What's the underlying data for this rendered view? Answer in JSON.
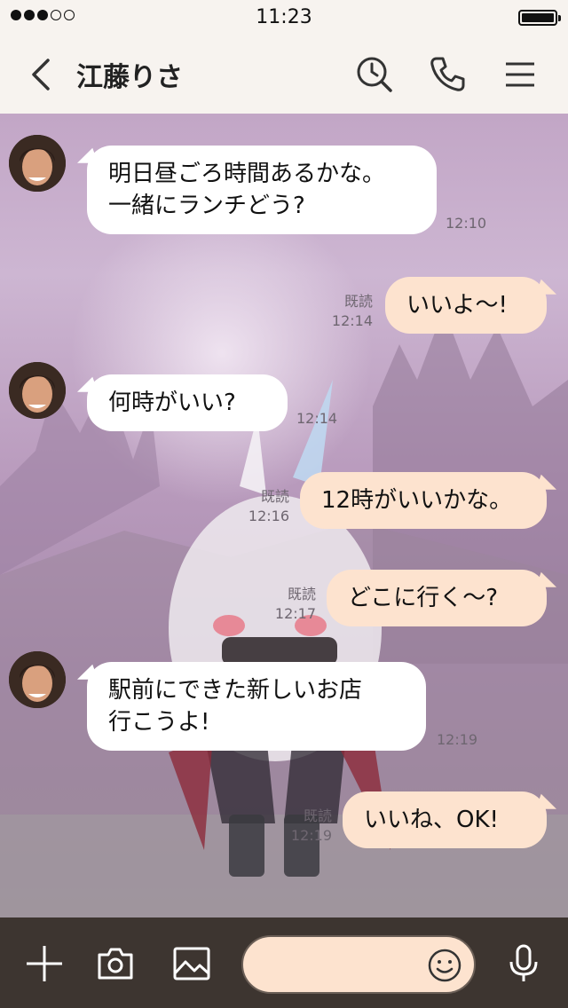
{
  "status": {
    "time": "11:23",
    "signal_bars_filled": 3,
    "signal_bars_total": 5,
    "battery_level": 1.0
  },
  "header": {
    "contact_name": "江藤りさ",
    "icons": [
      "back-chevron-icon",
      "search-history-icon",
      "phone-icon",
      "menu-icon"
    ]
  },
  "messages": [
    {
      "side": "in",
      "text": "明日昼ごろ時間あるかな。\n一緒にランチどう?",
      "time": "12:10",
      "read": ""
    },
    {
      "side": "out",
      "text": "いいよ〜!",
      "time": "12:14",
      "read": "既読"
    },
    {
      "side": "in",
      "text": "何時がいい?",
      "time": "12:14",
      "read": ""
    },
    {
      "side": "out",
      "text": "12時がいいかな。",
      "time": "12:16",
      "read": "既読"
    },
    {
      "side": "out",
      "text": "どこに行く〜?",
      "time": "12:17",
      "read": "既読"
    },
    {
      "side": "in",
      "text": "駅前にできた新しいお店\n行こうよ!",
      "time": "12:19",
      "read": ""
    },
    {
      "side": "out",
      "text": "いいね、OK!",
      "time": "12:19",
      "read": "既読"
    }
  ],
  "input": {
    "placeholder": "",
    "icons": [
      "plus-icon",
      "camera-icon",
      "image-icon",
      "emoji-icon",
      "microphone-icon"
    ]
  },
  "colors": {
    "bar_bg": "#f7f3ef",
    "input_bar_bg": "#3d3530",
    "incoming_bubble": "#ffffff",
    "outgoing_bubble": "#fde3cf"
  }
}
